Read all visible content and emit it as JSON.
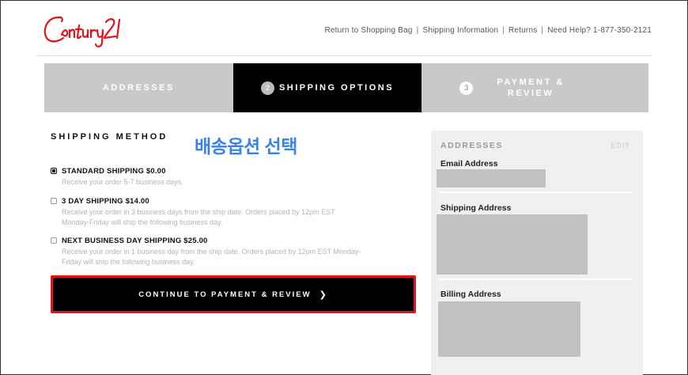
{
  "header": {
    "logo_text": "Century 21",
    "links": [
      "Return to Shopping Bag",
      "Shipping Information",
      "Returns",
      "Need Help? 1-877-350-2121"
    ]
  },
  "steps": [
    {
      "label": "ADDRESSES",
      "number": ""
    },
    {
      "label": "SHIPPING OPTIONS",
      "number": "2"
    },
    {
      "label_line1": "PAYMENT &",
      "label_line2": "REVIEW",
      "number": "3"
    }
  ],
  "shipping": {
    "title": "SHIPPING METHOD",
    "annotation": "배송옵션 선택",
    "options": [
      {
        "label": "STANDARD SHIPPING $0.00",
        "desc": "Receive your order 5-7 business days.",
        "selected": true
      },
      {
        "label": "3 DAY SHIPPING $14.00",
        "desc_line1": "Receive your order in 3 business days from the ship date. Orders placed by 12pm EST",
        "desc_line2": "Monday-Friday will ship the following business day.",
        "selected": false
      },
      {
        "label": "NEXT BUSINESS DAY SHIPPING $25.00",
        "desc_line1": "Receive your order in 1 business day from the ship date. Orders placed by 12pm EST Monday-",
        "desc_line2": "Friday will ship the following business day.",
        "selected": false
      }
    ],
    "continue_label": "CONTINUE TO PAYMENT & REVIEW",
    "continue_icon": "chevron-right-icon"
  },
  "summary": {
    "title": "ADDRESSES",
    "edit": "EDIT",
    "email_label": "Email Address",
    "shipping_label": "Shipping Address",
    "billing_label": "Billing Address"
  },
  "colors": {
    "accent_red": "#e3131b",
    "annotation_blue": "#3b82e6",
    "step_inactive": "#c9c9c9",
    "step_active": "#000000"
  }
}
